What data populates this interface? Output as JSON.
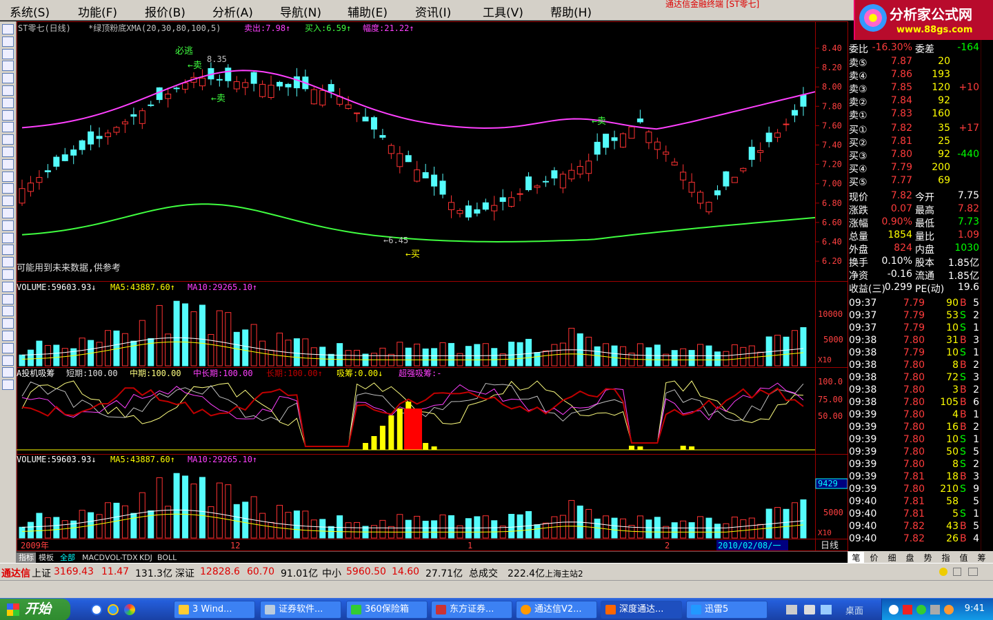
{
  "menu": [
    "系统(S)",
    "功能(F)",
    "报价(B)",
    "分析(A)",
    "导航(N)",
    "辅助(E)",
    "资讯(I)",
    "工具(V)",
    "帮助(H)"
  ],
  "window_title": "通达信金融终端 [ST零七]",
  "logo": {
    "text": "分析家公式网",
    "url": "www.88gs.com"
  },
  "chart": {
    "main_header": {
      "name": "ST零七(日线)",
      "indicator": "*绿顶粉底XMA(20,30,80,100,5)",
      "sell_label": "卖出:7.98↑",
      "buy_label": "买入:6.59↑",
      "range_label": "幅度:21.22↑"
    },
    "annotations": {
      "must_sell": "必逃",
      "high": "8.35",
      "sell1": "←卖",
      "sell2": "←卖",
      "sell3": "←卖",
      "low": "←6.45",
      "buy": "←买",
      "note": "可能用到未来数据,供参考"
    },
    "price_axis": [
      "8.40",
      "8.20",
      "8.00",
      "7.80",
      "7.60",
      "7.40",
      "7.20",
      "7.00",
      "6.80",
      "6.60",
      "6.40",
      "6.20"
    ],
    "vol_header": {
      "vol": "VOLUME:59603.93↓",
      "ma5": "MA5:43887.60↑",
      "ma10": "MA10:29265.10↑"
    },
    "vol_axis": [
      "10000",
      "5000"
    ],
    "vol_unit": "X10",
    "absorb_header": {
      "name": "A投机吸筹",
      "short": "短期:100.00",
      "mid": "中期:100.00",
      "midlong": "中长期:100.00",
      "long": "长期:100.00↑",
      "absorb": "吸筹:0.00↓",
      "super": "超强吸筹:-"
    },
    "absorb_axis": [
      "100.0",
      "75.00",
      "50.00"
    ],
    "vol2_axis": [
      "9429",
      "5000"
    ],
    "date_axis": {
      "y2009": "2009年",
      "m12": "12",
      "m1": "1",
      "m2": "2",
      "cursor_date": "2010/02/08/一",
      "period": "日线"
    }
  },
  "quote": {
    "wb": {
      "label1": "委比",
      "val1": "-16.30%",
      "label2": "委差",
      "val2": "-164"
    },
    "sells": [
      {
        "label": "卖⑤",
        "price": "7.87",
        "vol": "20",
        "chg": ""
      },
      {
        "label": "卖④",
        "price": "7.86",
        "vol": "193",
        "chg": ""
      },
      {
        "label": "卖③",
        "price": "7.85",
        "vol": "120",
        "chg": "+10"
      },
      {
        "label": "卖②",
        "price": "7.84",
        "vol": "92",
        "chg": ""
      },
      {
        "label": "卖①",
        "price": "7.83",
        "vol": "160",
        "chg": ""
      }
    ],
    "buys": [
      {
        "label": "买①",
        "price": "7.82",
        "vol": "35",
        "chg": "+17"
      },
      {
        "label": "买②",
        "price": "7.81",
        "vol": "25",
        "chg": ""
      },
      {
        "label": "买③",
        "price": "7.80",
        "vol": "92",
        "chg": "-440"
      },
      {
        "label": "买④",
        "price": "7.79",
        "vol": "200",
        "chg": ""
      },
      {
        "label": "买⑤",
        "price": "7.77",
        "vol": "69",
        "chg": ""
      }
    ],
    "stats": [
      {
        "l1": "现价",
        "v1": "7.82",
        "l2": "今开",
        "v2": "7.75",
        "c1": "#ff3c3c",
        "c2": "#ffffff"
      },
      {
        "l1": "涨跌",
        "v1": "0.07",
        "l2": "最高",
        "v2": "7.82",
        "c1": "#ff3c3c",
        "c2": "#ff3c3c"
      },
      {
        "l1": "涨幅",
        "v1": "0.90%",
        "l2": "最低",
        "v2": "7.73",
        "c1": "#ff3c3c",
        "c2": "#00ff00"
      },
      {
        "l1": "总量",
        "v1": "1854",
        "l2": "量比",
        "v2": "1.09",
        "c1": "#ffff00",
        "c2": "#ff3c3c"
      },
      {
        "l1": "外盘",
        "v1": "824",
        "l2": "内盘",
        "v2": "1030",
        "c1": "#ff3c3c",
        "c2": "#00ff00"
      },
      {
        "l1": "换手",
        "v1": "0.10%",
        "l2": "股本",
        "v2": "1.85亿",
        "c1": "#ffffff",
        "c2": "#ffffff"
      },
      {
        "l1": "净资",
        "v1": "-0.16",
        "l2": "流通",
        "v2": "1.85亿",
        "c1": "#ffffff",
        "c2": "#ffffff"
      },
      {
        "l1": "收益(三)",
        "v1": "0.299",
        "l2": "PE(动)",
        "v2": "19.6",
        "c1": "#ffffff",
        "c2": "#ffffff"
      }
    ],
    "ticks": [
      {
        "t": "09:37",
        "p": "7.79",
        "v": "90",
        "d": "B",
        "n": "5"
      },
      {
        "t": "09:37",
        "p": "7.79",
        "v": "53",
        "d": "S",
        "n": "2"
      },
      {
        "t": "09:37",
        "p": "7.79",
        "v": "10",
        "d": "S",
        "n": "1"
      },
      {
        "t": "09:38",
        "p": "7.80",
        "v": "31",
        "d": "B",
        "n": "3"
      },
      {
        "t": "09:38",
        "p": "7.79",
        "v": "10",
        "d": "S",
        "n": "1"
      },
      {
        "t": "09:38",
        "p": "7.80",
        "v": "8",
        "d": "B",
        "n": "2"
      },
      {
        "t": "09:38",
        "p": "7.80",
        "v": "72",
        "d": "S",
        "n": "3"
      },
      {
        "t": "09:38",
        "p": "7.80",
        "v": "3",
        "d": "B",
        "n": "2"
      },
      {
        "t": "09:38",
        "p": "7.80",
        "v": "105",
        "d": "B",
        "n": "6"
      },
      {
        "t": "09:39",
        "p": "7.80",
        "v": "4",
        "d": "B",
        "n": "1"
      },
      {
        "t": "09:39",
        "p": "7.80",
        "v": "16",
        "d": "B",
        "n": "2"
      },
      {
        "t": "09:39",
        "p": "7.80",
        "v": "10",
        "d": "S",
        "n": "1"
      },
      {
        "t": "09:39",
        "p": "7.80",
        "v": "50",
        "d": "S",
        "n": "5"
      },
      {
        "t": "09:39",
        "p": "7.80",
        "v": "8",
        "d": "S",
        "n": "2"
      },
      {
        "t": "09:39",
        "p": "7.81",
        "v": "18",
        "d": "B",
        "n": "3"
      },
      {
        "t": "09:39",
        "p": "7.80",
        "v": "210",
        "d": "S",
        "n": "9"
      },
      {
        "t": "09:40",
        "p": "7.81",
        "v": "58",
        "d": "",
        "n": "5"
      },
      {
        "t": "09:40",
        "p": "7.81",
        "v": "5",
        "d": "S",
        "n": "1"
      },
      {
        "t": "09:40",
        "p": "7.82",
        "v": "43",
        "d": "B",
        "n": "5"
      },
      {
        "t": "09:40",
        "p": "7.82",
        "v": "26",
        "d": "B",
        "n": "4"
      }
    ]
  },
  "bottom_tabs": [
    "指标",
    "模板",
    "全部",
    "MACD",
    "VOL-TDX",
    "KDJ",
    "BOLL"
  ],
  "right_tabs": [
    "笔",
    "价",
    "细",
    "盘",
    "势",
    "指",
    "值",
    "筹"
  ],
  "status": {
    "brand": "通达信",
    "sh": {
      "name": "上证",
      "val": "3169.43",
      "chg": "11.47",
      "amt": "131.3亿"
    },
    "sz": {
      "name": "深证",
      "val": "12828.6",
      "chg": "60.70",
      "amt": "91.01亿"
    },
    "zx": {
      "name": "中小",
      "val": "5960.50",
      "chg": "14.60",
      "amt": "27.71亿"
    },
    "total": {
      "name": "总成交",
      "amt": "222.4亿"
    },
    "station": "上海主站2"
  },
  "taskbar": {
    "start": "开始",
    "tasks": [
      "3 Wind...",
      "证券软件...",
      "360保险箱",
      "东方证券...",
      "通达信V2...",
      "深度通达...",
      "迅雷5"
    ],
    "tray_label": "桌面",
    "clock": "9:41"
  }
}
